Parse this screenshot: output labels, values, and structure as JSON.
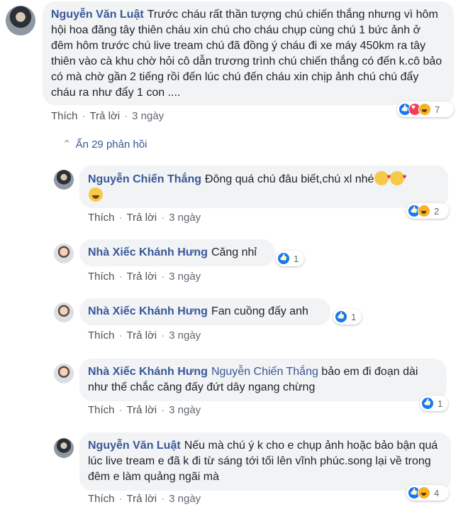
{
  "comments": [
    {
      "name": "Nguyễn Văn Luật",
      "text": "Trước cháu rất thần tượng chú chiến thắng nhưng vì hôm hội hoa đăng tây thiên cháu xin chú cho cháu chụp cùng chú 1 bức ảnh ở đêm hôm trước chú live tream chú đã đồng ý cháu đi xe máy 450km ra tây thiên vào cà khu chờ hỏi cô dẫn trương trình chú chiến thắng có đến k.cô bảo có mà chờ gần 2 tiếng rồi đến lúc chú đến cháu xin chịp ảnh chú chú đẩy cháu ra như đẩy 1 con ....",
      "actions": {
        "like": "Thích",
        "reply": "Trả lời",
        "time": "3 ngày"
      },
      "reactions": {
        "icons": [
          "like-icon",
          "love-icon",
          "haha-icon"
        ],
        "count": "7"
      }
    }
  ],
  "hide_replies": "Ẩn 29 phản hồi",
  "replies": [
    {
      "name": "Nguyễn Chiến Thắng",
      "text": "Đông quá chú đâu biết,chú xl nhé",
      "actions": {
        "like": "Thích",
        "reply": "Trả lời",
        "time": "3 ngày"
      },
      "reactions": {
        "icons": [
          "like-icon",
          "haha-icon"
        ],
        "count": "2"
      }
    },
    {
      "name": "Nhà Xiếc Khánh Hưng",
      "text": "Căng nhỉ",
      "actions": {
        "like": "Thích",
        "reply": "Trả lời",
        "time": "3 ngày"
      },
      "reactions": {
        "icons": [
          "like-icon"
        ],
        "count": "1"
      }
    },
    {
      "name": "Nhà Xiếc Khánh Hưng",
      "text": "Fan cuồng đấy anh",
      "actions": {
        "like": "Thích",
        "reply": "Trả lời",
        "time": "3 ngày"
      },
      "reactions": {
        "icons": [
          "like-icon"
        ],
        "count": "1"
      }
    },
    {
      "name": "Nhà Xiếc Khánh Hưng",
      "mention": "Nguyễn Chiến Thắng",
      "text": "bảo em đi đoạn dài như thế chắc căng đấy đứt dây ngang chừng",
      "actions": {
        "like": "Thích",
        "reply": "Trả lời",
        "time": "3 ngày"
      },
      "reactions": {
        "icons": [
          "like-icon"
        ],
        "count": "1"
      }
    },
    {
      "name": "Nguyễn Văn Luật",
      "text": "Nếu mà chú ý k cho e chụp ảnh hoặc bảo bận quá lúc live tream e đã k đi từ sáng tới tối lên vĩnh phúc.song lại về trong đêm e làm quảng ngãi mà",
      "actions": {
        "like": "Thích",
        "reply": "Trả lời",
        "time": "3 ngày"
      },
      "reactions": {
        "icons": [
          "like-icon",
          "haha-icon"
        ],
        "count": "4"
      }
    }
  ],
  "colors": {
    "link": "#385898",
    "bubble": "#f2f3f5",
    "like": "#1877f2",
    "love": "#f33e58",
    "haha": "#f7b125"
  }
}
